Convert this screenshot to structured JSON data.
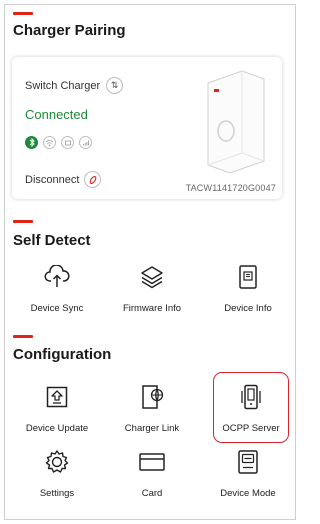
{
  "sections": {
    "pairing": {
      "title": "Charger Pairing"
    },
    "self_detect": {
      "title": "Self Detect"
    },
    "configuration": {
      "title": "Configuration"
    }
  },
  "charger_card": {
    "switch_label": "Switch Charger",
    "status": "Connected",
    "disconnect_label": "Disconnect",
    "serial": "TACW1141720G0047",
    "status_icons": [
      "bluetooth-icon",
      "wifi-icon",
      "ethernet-icon",
      "cellular-icon"
    ]
  },
  "self_detect_items": [
    {
      "label": "Device Sync",
      "icon": "cloud-upload-icon"
    },
    {
      "label": "Firmware Info",
      "icon": "layers-icon"
    },
    {
      "label": "Device Info",
      "icon": "device-info-icon"
    }
  ],
  "configuration_items": [
    {
      "label": "Device Update",
      "icon": "device-update-icon"
    },
    {
      "label": "Charger Link",
      "icon": "charger-link-icon"
    },
    {
      "label": "OCPP Server",
      "icon": "ocpp-server-icon",
      "highlighted": true
    },
    {
      "label": "Settings",
      "icon": "gear-icon"
    },
    {
      "label": "Card",
      "icon": "card-icon"
    },
    {
      "label": "Device Mode",
      "icon": "device-mode-icon"
    }
  ],
  "colors": {
    "accent": "#e2231a",
    "connected": "#1d8a3a",
    "highlight": "#d9232e"
  }
}
